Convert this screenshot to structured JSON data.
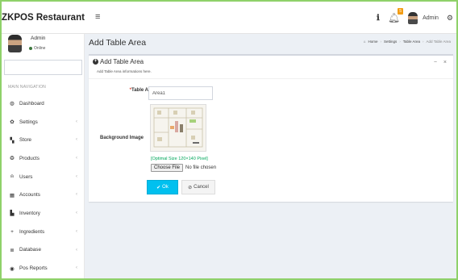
{
  "app": {
    "brand": "ZKPOS Restaurant"
  },
  "topbar": {
    "menu_icon": "hamburger-icon",
    "info_icon": "info-icon",
    "notification_icon": "bell-icon",
    "notification_count": "5",
    "user_name": "Admin",
    "settings_icon": "gears-icon"
  },
  "sidebar": {
    "user_name": "Admin",
    "status": "Online",
    "status_color": "#3c763d",
    "search_placeholder": "",
    "header": "MAIN NAVIGATION",
    "items": [
      {
        "label": "Dashboard",
        "icon": "dashboard-icon",
        "caret": ""
      },
      {
        "label": "Settings",
        "icon": "gear-icon",
        "caret": "‹"
      },
      {
        "label": "Store",
        "icon": "store-icon",
        "caret": "‹"
      },
      {
        "label": "Products",
        "icon": "products-icon",
        "caret": "‹"
      },
      {
        "label": "Users",
        "icon": "user-icon",
        "caret": "‹"
      },
      {
        "label": "Accounts",
        "icon": "accounts-icon",
        "caret": "‹"
      },
      {
        "label": "Inventory",
        "icon": "inventory-icon",
        "caret": "‹"
      },
      {
        "label": "Ingredients",
        "icon": "plus-icon",
        "caret": "‹"
      },
      {
        "label": "Database",
        "icon": "database-icon",
        "caret": "‹"
      },
      {
        "label": "Pos Reports",
        "icon": "eye-icon",
        "caret": "‹"
      }
    ]
  },
  "page": {
    "title": "Add Table Area",
    "breadcrumb": [
      "Home",
      "Settings",
      "Table Area",
      "Add Table Area"
    ]
  },
  "form": {
    "title": "Add Table Area",
    "subtitle": "Add Table Area informations here.",
    "area_label": "Table Area",
    "area_required_mark": "*",
    "area_value": "Area1",
    "bg_label": "Background Image",
    "size_hint": "[Optimal Size 120×140 Pixel]",
    "file_button": "Choose File",
    "file_status": "No file chosen",
    "ok_label": "Ok",
    "cancel_label": "Cancel",
    "ok_color": "#00c0ef"
  }
}
